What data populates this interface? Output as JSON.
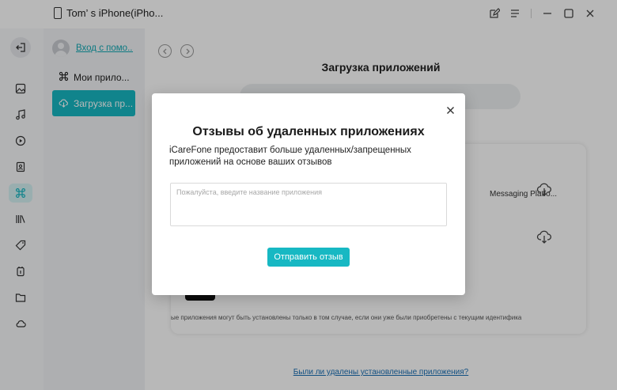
{
  "titlebar": {
    "device_name": "Tom’ s iPhone(iPho...",
    "icons": [
      "edit-icon",
      "menu-icon",
      "minimize-icon",
      "maximize-icon",
      "close-icon"
    ]
  },
  "rail": {
    "items": [
      {
        "icon": "exit-icon"
      },
      {
        "icon": "photos-icon"
      },
      {
        "icon": "music-icon"
      },
      {
        "icon": "video-icon"
      },
      {
        "icon": "contacts-icon"
      },
      {
        "icon": "apps-icon",
        "active": true
      },
      {
        "icon": "books-icon"
      },
      {
        "icon": "tag-icon"
      },
      {
        "icon": "backup-icon"
      },
      {
        "icon": "folder-icon"
      },
      {
        "icon": "cloud-icon"
      }
    ]
  },
  "sidebar": {
    "help_link": "Вход с помо...",
    "items": [
      {
        "label": "Мои прило...",
        "icon": "apps-icon"
      },
      {
        "label": "Загрузка пр...",
        "icon": "cloud-download-icon",
        "active": true
      }
    ]
  },
  "main": {
    "title": "Загрузка приложений",
    "card": {
      "item_text": "Messaging Platfo...",
      "footer_text": "ые приложения могут быть установлены только в том случае, если они уже были приобретены с текущим идентифика"
    },
    "bottom_link": "Были ли удалены установленные приложения?"
  },
  "dialog": {
    "title": "Отзывы об удаленных приложениях",
    "description": "iCareFone предоставит больше удаленных/запрещенных приложений на основе ваших отзывов",
    "input_placeholder": "Пожалуйста, введите название приложения",
    "input_value": "",
    "submit_label": "Отправить отзыв"
  },
  "colors": {
    "accent": "#17b8c3",
    "link": "#1a6fb5",
    "overlay": "rgba(0,0,0,0.28)"
  }
}
